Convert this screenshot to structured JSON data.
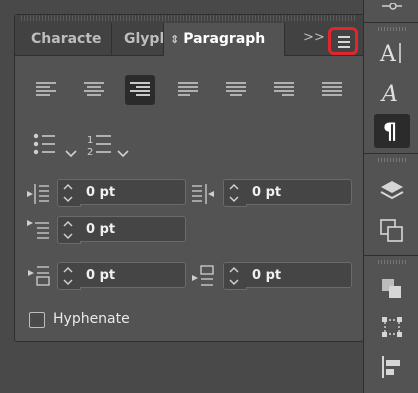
{
  "tabs": [
    {
      "label": "Characte"
    },
    {
      "label": "Glyphs"
    },
    {
      "label": "Paragraph"
    }
  ],
  "icons": {
    "collapse": "double-chevron-right-icon",
    "menu": "hamburger-menu-icon",
    "updown": "up-down-arrows-icon"
  },
  "paragraph": {
    "alignment_buttons": [
      "align-left",
      "align-center",
      "align-right",
      "justify-last-left",
      "justify-last-center",
      "justify-last-right",
      "justify-all"
    ],
    "active_alignment": "align-right",
    "bullets_icon": "bullet-list-icon",
    "numbering_icon": "numbered-list-icon",
    "left_indent": "0 pt",
    "right_indent": "0 pt",
    "first_line_indent": "0 pt",
    "space_before": "0 pt",
    "space_after": "0 pt",
    "hyphenate_label": "Hyphenate",
    "hyphenate_checked": false
  },
  "toolbar": {
    "items": [
      "properties-icon",
      "character-icon",
      "opentype-icon",
      "paragraph-icon",
      "layers-icon",
      "artboards-icon",
      "pathfinder-icon",
      "transform-icon",
      "align-icon"
    ],
    "active": "paragraph-icon"
  },
  "colors": {
    "panel_bg": "#535353",
    "tab_bg": "#424242",
    "highlight": "#e2262b",
    "active_bg": "#2b2b2b"
  }
}
